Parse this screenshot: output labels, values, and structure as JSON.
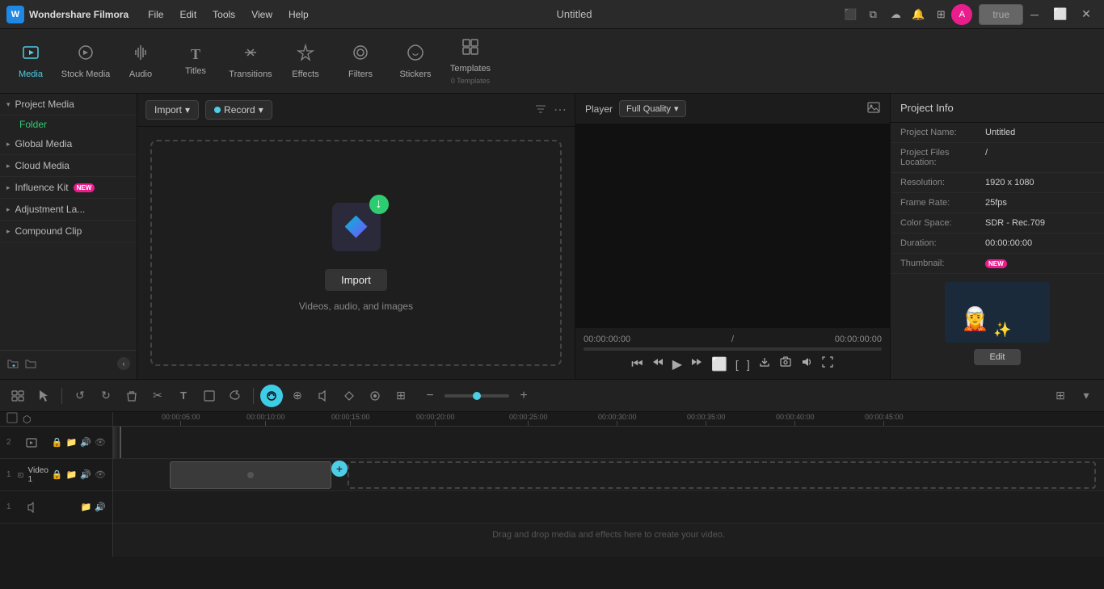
{
  "app": {
    "name": "Wondershare Filmora",
    "title": "Untitled",
    "logo_text": "W"
  },
  "menu": {
    "items": [
      "File",
      "Edit",
      "Tools",
      "View",
      "Help"
    ]
  },
  "toolbar": {
    "items": [
      {
        "id": "media",
        "label": "Media",
        "icon": "⬛",
        "active": true
      },
      {
        "id": "stock-media",
        "label": "Stock Media",
        "icon": "🎵"
      },
      {
        "id": "audio",
        "label": "Audio",
        "icon": "♪"
      },
      {
        "id": "titles",
        "label": "Titles",
        "icon": "T"
      },
      {
        "id": "transitions",
        "label": "Transitions",
        "icon": "⇄"
      },
      {
        "id": "effects",
        "label": "Effects",
        "icon": "✦"
      },
      {
        "id": "filters",
        "label": "Filters",
        "icon": "⬡"
      },
      {
        "id": "stickers",
        "label": "Stickers",
        "icon": "⬣"
      },
      {
        "id": "templates",
        "label": "Templates",
        "icon": "⊞"
      }
    ],
    "templates_count": "0 Templates"
  },
  "sidebar": {
    "sections": [
      {
        "id": "project-media",
        "label": "Project Media",
        "expanded": true
      },
      {
        "id": "global-media",
        "label": "Global Media"
      },
      {
        "id": "cloud-media",
        "label": "Cloud Media"
      },
      {
        "id": "influence-kit",
        "label": "Influence Kit",
        "badge": "NEW"
      },
      {
        "id": "adjustment-layer",
        "label": "Adjustment La..."
      },
      {
        "id": "compound-clip",
        "label": "Compound Clip"
      }
    ],
    "folder_label": "Folder"
  },
  "media_panel": {
    "import_label": "Import",
    "record_label": "Record",
    "drop_zone_text": "Videos, audio, and images",
    "import_btn_label": "Import"
  },
  "player": {
    "tab": "Player",
    "quality": "Full Quality",
    "quality_label": "Quality",
    "time_current": "00:00:00:00",
    "time_total": "00:00:00:00",
    "separator": "/"
  },
  "project_info": {
    "title": "Project Info",
    "fields": [
      {
        "label": "Project Name:",
        "value": "Untitled"
      },
      {
        "label": "Project Files Location:",
        "value": "/"
      },
      {
        "label": "Resolution:",
        "value": "1920 x 1080"
      },
      {
        "label": "Frame Rate:",
        "value": "25fps"
      },
      {
        "label": "Color Space:",
        "value": "SDR - Rec.709"
      },
      {
        "label": "Duration:",
        "value": "00:00:00:00"
      },
      {
        "label": "Thumbnail:",
        "value": "",
        "badge": "NEW"
      }
    ],
    "edit_btn": "Edit"
  },
  "timeline": {
    "toolbar_icons": [
      "⊞",
      "↺",
      "↻",
      "🗑",
      "✂",
      "T",
      "⬜",
      "↕",
      "⬚"
    ],
    "hint_text": "Drag and drop media and effects here to create your video.",
    "tracks": [
      {
        "id": "track2",
        "num": "2",
        "type": "video"
      },
      {
        "id": "track1",
        "num": "1",
        "type": "video",
        "label": "Video 1"
      },
      {
        "id": "audio1",
        "num": "1",
        "type": "audio"
      }
    ],
    "time_marks": [
      "00:00:05:00",
      "00:00:10:00",
      "00:00:15:00",
      "00:00:20:00",
      "00:00:25:00",
      "00:00:30:00",
      "00:00:35:00",
      "00:00:40:00",
      "00:00:45:00"
    ]
  },
  "icons": {
    "minimize": "─",
    "maximize": "⬜",
    "close": "✕",
    "chevron_down": "▾",
    "chevron_right": "▸",
    "add": "+",
    "filter": "⚙",
    "more": "⋯",
    "play": "▶",
    "prev_frame": "⏮",
    "next_frame": "⏭",
    "stop": "⏹",
    "in_mark": "[",
    "out_mark": "]",
    "snapshot": "📷",
    "vol": "🔊",
    "fullscreen": "⛶"
  }
}
